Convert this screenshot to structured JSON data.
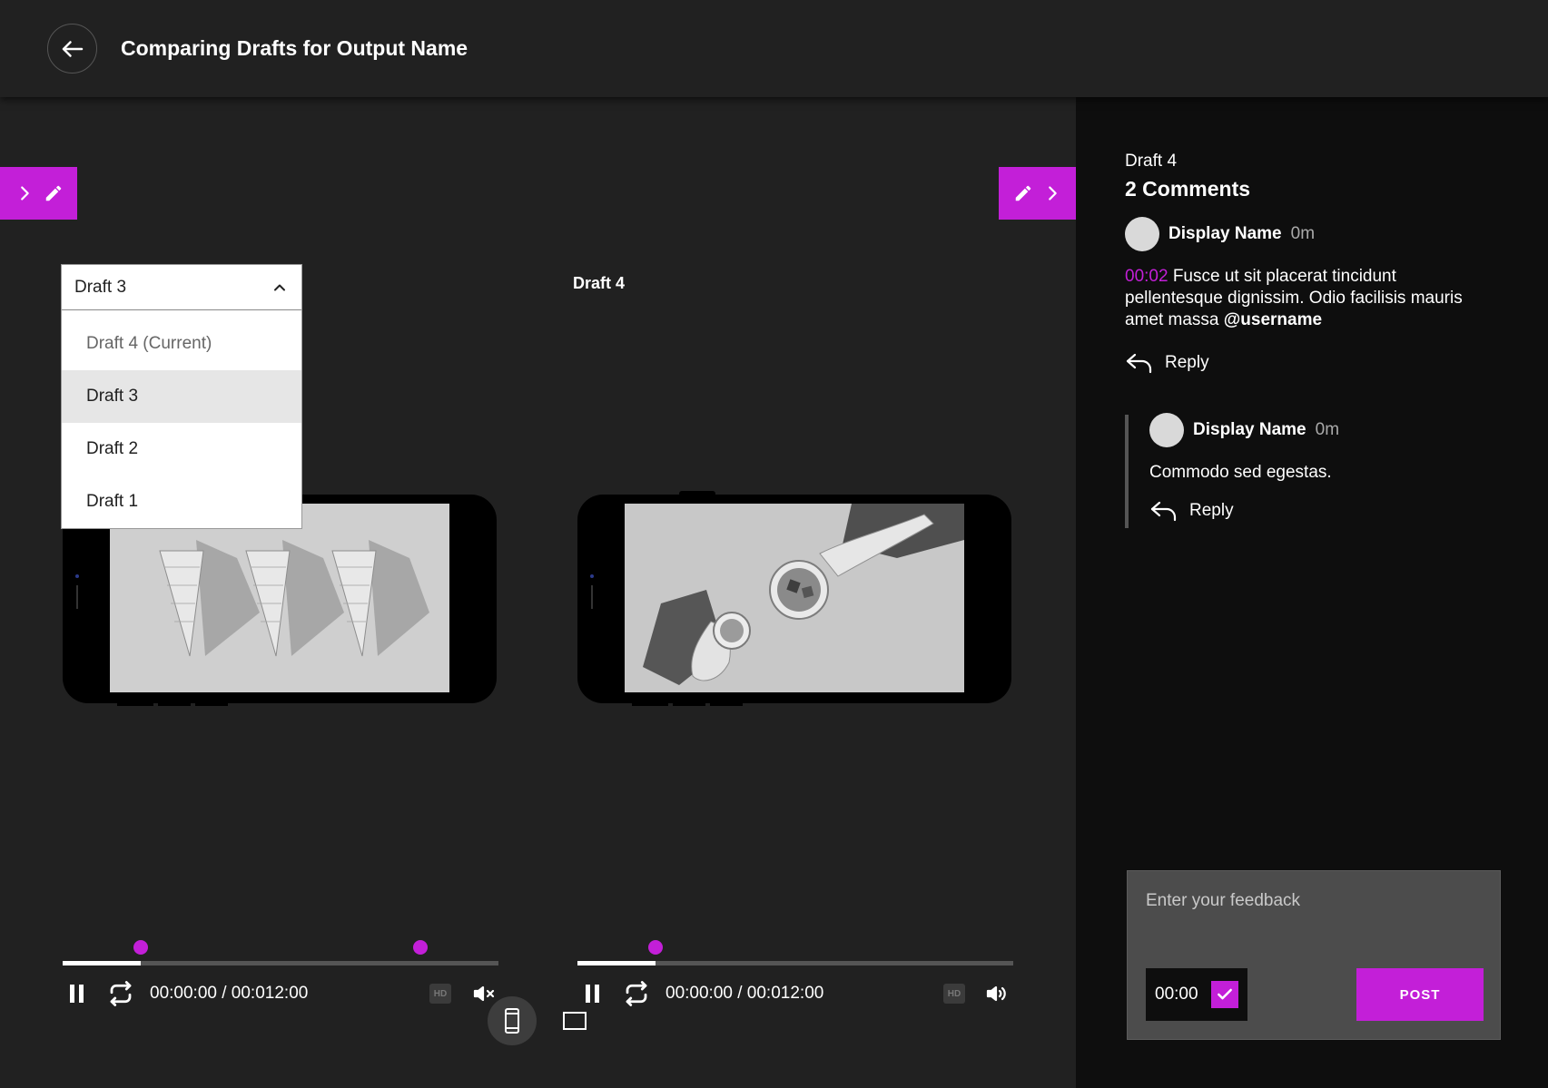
{
  "header": {
    "title": "Comparing Drafts for Output Name"
  },
  "compare": {
    "left": {
      "selected": "Draft 3",
      "options": [
        "Draft 4 (Current)",
        "Draft 3",
        "Draft 2",
        "Draft 1"
      ],
      "time": "00:00:00 / 00:012:00",
      "progress": 0.18,
      "markers": [
        0.18,
        0.82
      ],
      "muted": true
    },
    "right": {
      "label": "Draft 4",
      "time": "00:00:00 / 00:012:00",
      "progress": 0.18,
      "markers": [
        0.18
      ],
      "muted": false
    },
    "hd_label": "HD"
  },
  "comments": {
    "draft": "Draft 4",
    "count_label": "2 Comments",
    "items": [
      {
        "name": "Display Name",
        "time": "0m",
        "timestamp": "00:02",
        "text": " Fusce ut sit placerat tincidunt pellentesque dignissim. Odio facilisis mauris amet massa ",
        "mention": "@username",
        "reply_label": "Reply"
      },
      {
        "name": "Display Name",
        "time": "0m",
        "text": "Commodo sed egestas.",
        "reply_label": "Reply"
      }
    ]
  },
  "feedback": {
    "placeholder": "Enter your feedback",
    "timestamp": "00:00",
    "post_label": "POST"
  },
  "colors": {
    "accent": "#c31fd8",
    "panel": "#0e0e0e",
    "background": "#212121"
  }
}
